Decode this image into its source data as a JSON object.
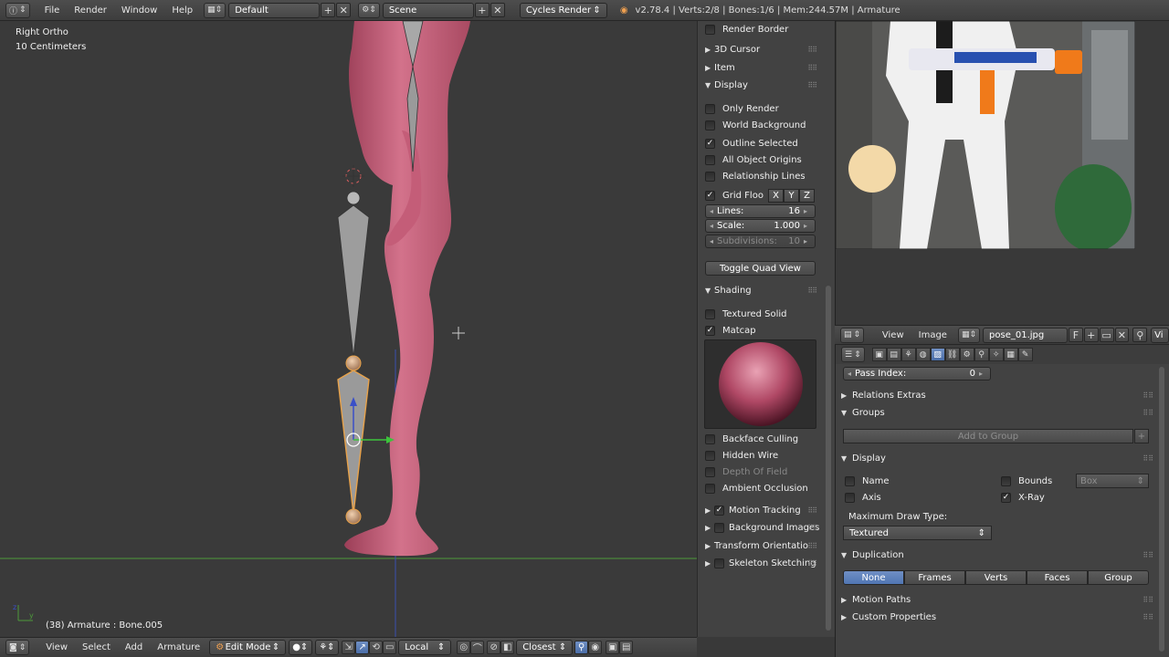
{
  "topbar": {
    "menus": [
      "File",
      "Render",
      "Window",
      "Help"
    ],
    "screen_layout": "Default",
    "scene": "Scene",
    "render_engine": "Cycles Render",
    "stats": "v2.78.4 | Verts:2/8 | Bones:1/6 | Mem:244.57M | Armature"
  },
  "viewport": {
    "view_name": "Right Ortho",
    "scale": "10 Centimeters",
    "status": "(38) Armature : Bone.005"
  },
  "bottombar": {
    "menus": [
      "View",
      "Select",
      "Add",
      "Armature"
    ],
    "mode": "Edit Mode",
    "orientation": "Local",
    "snap_target": "Closest"
  },
  "npanel": {
    "render_border": "Render Border",
    "sections_collapsed": [
      "3D Cursor",
      "Item"
    ],
    "display": {
      "title": "Display",
      "options": [
        {
          "label": "Only Render",
          "checked": false
        },
        {
          "label": "World Background",
          "checked": false
        },
        {
          "label": "Outline Selected",
          "checked": true
        },
        {
          "label": "All Object Origins",
          "checked": false
        },
        {
          "label": "Relationship Lines",
          "checked": false
        }
      ],
      "grid_floor": {
        "label": "Grid Floo",
        "checked": true
      },
      "axes": [
        "X",
        "Y",
        "Z"
      ],
      "lines": {
        "label": "Lines:",
        "value": "16"
      },
      "scale": {
        "label": "Scale:",
        "value": "1.000"
      },
      "subdivisions": {
        "label": "Subdivisions:",
        "value": "10"
      },
      "toggle_quad": "Toggle Quad View"
    },
    "shading": {
      "title": "Shading",
      "textured_solid": {
        "label": "Textured Solid",
        "checked": false
      },
      "matcap": {
        "label": "Matcap",
        "checked": true
      },
      "options": [
        {
          "label": "Backface Culling",
          "checked": false
        },
        {
          "label": "Hidden Wire",
          "checked": false
        },
        {
          "label": "Depth Of Field",
          "checked": false,
          "disabled": true
        },
        {
          "label": "Ambient Occlusion",
          "checked": false
        }
      ]
    },
    "bottom_sections": [
      {
        "label": "Motion Tracking",
        "checkbox": true,
        "checked": true
      },
      {
        "label": "Background Images",
        "checkbox": true,
        "checked": false
      },
      {
        "label": "Transform Orientatio",
        "checkbox": false
      },
      {
        "label": "Skeleton Sketching",
        "checkbox": true,
        "checked": false
      }
    ]
  },
  "image_editor": {
    "menus": [
      "View",
      "Image"
    ],
    "image_name": "pose_01.jpg",
    "fake_user": "F",
    "trailing": "Vi"
  },
  "properties": {
    "pass_index": {
      "label": "Pass Index:",
      "value": "0"
    },
    "relations_extras": "Relations Extras",
    "groups": {
      "title": "Groups",
      "add_button": "Add to Group"
    },
    "display": {
      "title": "Display",
      "name": {
        "label": "Name",
        "checked": false
      },
      "axis": {
        "label": "Axis",
        "checked": false
      },
      "bounds": {
        "label": "Bounds",
        "checked": false
      },
      "bounds_type": "Box",
      "xray": {
        "label": "X-Ray",
        "checked": true
      },
      "max_draw_label": "Maximum Draw Type:",
      "max_draw_value": "Textured"
    },
    "duplication": {
      "title": "Duplication",
      "options": [
        "None",
        "Frames",
        "Verts",
        "Faces",
        "Group"
      ],
      "selected": "None"
    },
    "motion_paths": "Motion Paths",
    "custom_properties": "Custom Properties"
  },
  "colors": {
    "accent": "#5680c2",
    "skin": "#c9607a",
    "bone_selected": "#e8a24a",
    "axis_green": "#4d9a3a",
    "axis_blue": "#3a50b0"
  }
}
